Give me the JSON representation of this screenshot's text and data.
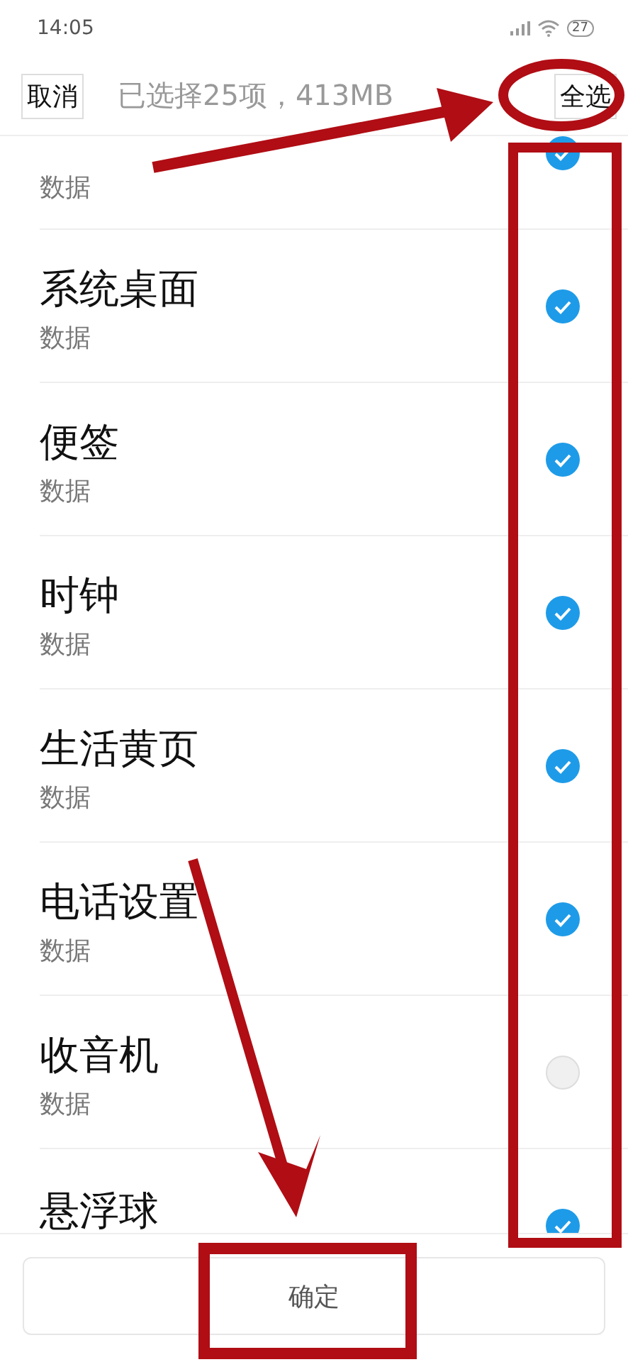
{
  "status_bar": {
    "time": "14:05",
    "battery": "27"
  },
  "header": {
    "cancel": "取消",
    "title": "已选择25项，413MB",
    "select_all": "全选"
  },
  "items": [
    {
      "subtitle": "数据",
      "checked": true
    },
    {
      "title": "系统桌面",
      "subtitle": "数据",
      "checked": true
    },
    {
      "title": "便签",
      "subtitle": "数据",
      "checked": true
    },
    {
      "title": "时钟",
      "subtitle": "数据",
      "checked": true
    },
    {
      "title": "生活黄页",
      "subtitle": "数据",
      "checked": true
    },
    {
      "title": "电话设置",
      "subtitle": "数据",
      "checked": true
    },
    {
      "title": "收音机",
      "subtitle": "数据",
      "checked": false
    },
    {
      "title": "悬浮球",
      "checked": true
    }
  ],
  "confirm": "确定"
}
